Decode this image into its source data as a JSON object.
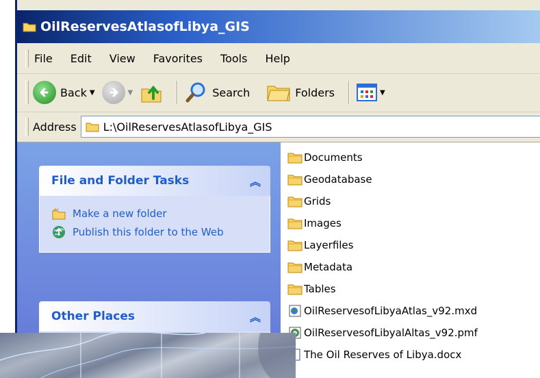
{
  "window": {
    "title": "OilReservesAtlasofLibya_GIS"
  },
  "menu": [
    "File",
    "Edit",
    "View",
    "Favorites",
    "Tools",
    "Help"
  ],
  "toolbar": {
    "back_label": "Back",
    "search_label": "Search",
    "folders_label": "Folders"
  },
  "address": {
    "label": "Address",
    "value": "L:\\OilReservesAtlasofLibya_GIS"
  },
  "tasks": {
    "file_folder": {
      "title": "File and Folder Tasks",
      "items": [
        "Make a new folder",
        "Publish this folder to the Web"
      ]
    },
    "other_places": {
      "title": "Other Places"
    }
  },
  "files": [
    {
      "name": "Documents",
      "icon": "folder-icon"
    },
    {
      "name": "Geodatabase",
      "icon": "folder-icon"
    },
    {
      "name": "Grids",
      "icon": "folder-icon"
    },
    {
      "name": "Images",
      "icon": "folder-icon"
    },
    {
      "name": "Layerfiles",
      "icon": "folder-icon"
    },
    {
      "name": "Metadata",
      "icon": "folder-icon"
    },
    {
      "name": "Tables",
      "icon": "folder-icon"
    },
    {
      "name": "OilReservesofLibyaAtlas_v92.mxd",
      "icon": "mxd-file-icon"
    },
    {
      "name": "OilReservesofLibyalAltas_v92.pmf",
      "icon": "pmf-file-icon"
    },
    {
      "name": "The Oil Reserves of Libya.docx",
      "icon": "word-doc-icon"
    }
  ],
  "colors": {
    "title_gradient_start": "#0a246a",
    "taskpane_blue": "#7ba2e7",
    "task_link": "#215dc6",
    "folder_yellow": "#f7d46a"
  }
}
